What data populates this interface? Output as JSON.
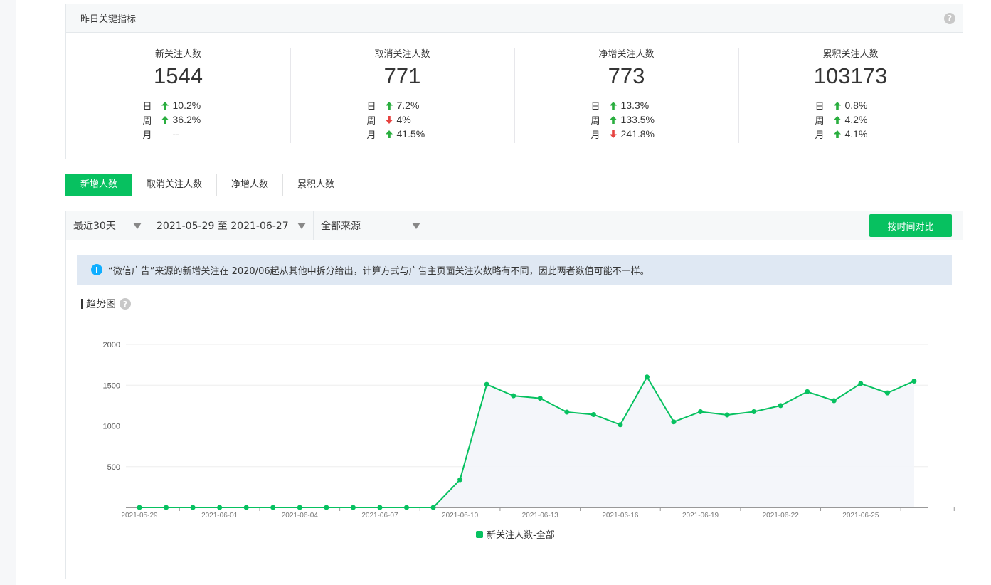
{
  "kpi": {
    "title": "昨日关键指标",
    "help": "?",
    "metrics": [
      {
        "name": "新关注人数",
        "value": "1544",
        "changes": [
          {
            "label": "日",
            "dir": "up",
            "value": "10.2%"
          },
          {
            "label": "周",
            "dir": "up",
            "value": "36.2%"
          },
          {
            "label": "月",
            "dir": "none",
            "value": "--"
          }
        ]
      },
      {
        "name": "取消关注人数",
        "value": "771",
        "changes": [
          {
            "label": "日",
            "dir": "up",
            "value": "7.2%"
          },
          {
            "label": "周",
            "dir": "down",
            "value": "4%"
          },
          {
            "label": "月",
            "dir": "up",
            "value": "41.5%"
          }
        ]
      },
      {
        "name": "净增关注人数",
        "value": "773",
        "changes": [
          {
            "label": "日",
            "dir": "up",
            "value": "13.3%"
          },
          {
            "label": "周",
            "dir": "up",
            "value": "133.5%"
          },
          {
            "label": "月",
            "dir": "down",
            "value": "241.8%"
          }
        ]
      },
      {
        "name": "累积关注人数",
        "value": "103173",
        "changes": [
          {
            "label": "日",
            "dir": "up",
            "value": "0.8%"
          },
          {
            "label": "周",
            "dir": "up",
            "value": "4.2%"
          },
          {
            "label": "月",
            "dir": "up",
            "value": "4.1%"
          }
        ]
      }
    ]
  },
  "tabs": [
    {
      "label": "新增人数",
      "active": true
    },
    {
      "label": "取消关注人数",
      "active": false
    },
    {
      "label": "净增人数",
      "active": false
    },
    {
      "label": "累积人数",
      "active": false
    }
  ],
  "filters": {
    "period": "最近30天",
    "range": "2021-05-29 至 2021-06-27",
    "source": "全部来源",
    "compare_button": "按时间对比"
  },
  "notice": {
    "icon": "i",
    "text": "“微信广告”来源的新增关注在 2020/06起从其他中拆分给出，计算方式与广告主页面关注次数略有不同，因此两者数值可能不一样。"
  },
  "trend": {
    "title": "趋势图",
    "help": "?"
  },
  "colors": {
    "accent": "#07c160",
    "up": "#2aae3f",
    "down": "#e64340"
  },
  "chart_data": {
    "type": "area",
    "ylim": [
      0,
      2000
    ],
    "yticks": [
      2000,
      1500,
      1000,
      500
    ],
    "x": [
      "2021-05-29",
      "2021-05-30",
      "2021-05-31",
      "2021-06-01",
      "2021-06-02",
      "2021-06-03",
      "2021-06-04",
      "2021-06-05",
      "2021-06-06",
      "2021-06-07",
      "2021-06-08",
      "2021-06-09",
      "2021-06-10",
      "2021-06-11",
      "2021-06-12",
      "2021-06-13",
      "2021-06-14",
      "2021-06-15",
      "2021-06-16",
      "2021-06-17",
      "2021-06-18",
      "2021-06-19",
      "2021-06-20",
      "2021-06-21",
      "2021-06-22",
      "2021-06-23",
      "2021-06-24",
      "2021-06-25",
      "2021-06-26",
      "2021-06-27"
    ],
    "xtick_labels": [
      "2021-05-29",
      "2021-06-01",
      "2021-06-04",
      "2021-06-07",
      "2021-06-10",
      "2021-06-13",
      "2021-06-16",
      "2021-06-19",
      "2021-06-22",
      "2021-06-25"
    ],
    "series": [
      {
        "name": "新关注人数-全部",
        "values": [
          0,
          0,
          0,
          0,
          0,
          0,
          0,
          0,
          0,
          0,
          0,
          0,
          340,
          1510,
          1370,
          1340,
          1170,
          1140,
          1015,
          1600,
          1050,
          1175,
          1135,
          1175,
          1250,
          1420,
          1310,
          1520,
          1405,
          1550
        ]
      }
    ],
    "legend": "bottom-center",
    "grid": true
  }
}
